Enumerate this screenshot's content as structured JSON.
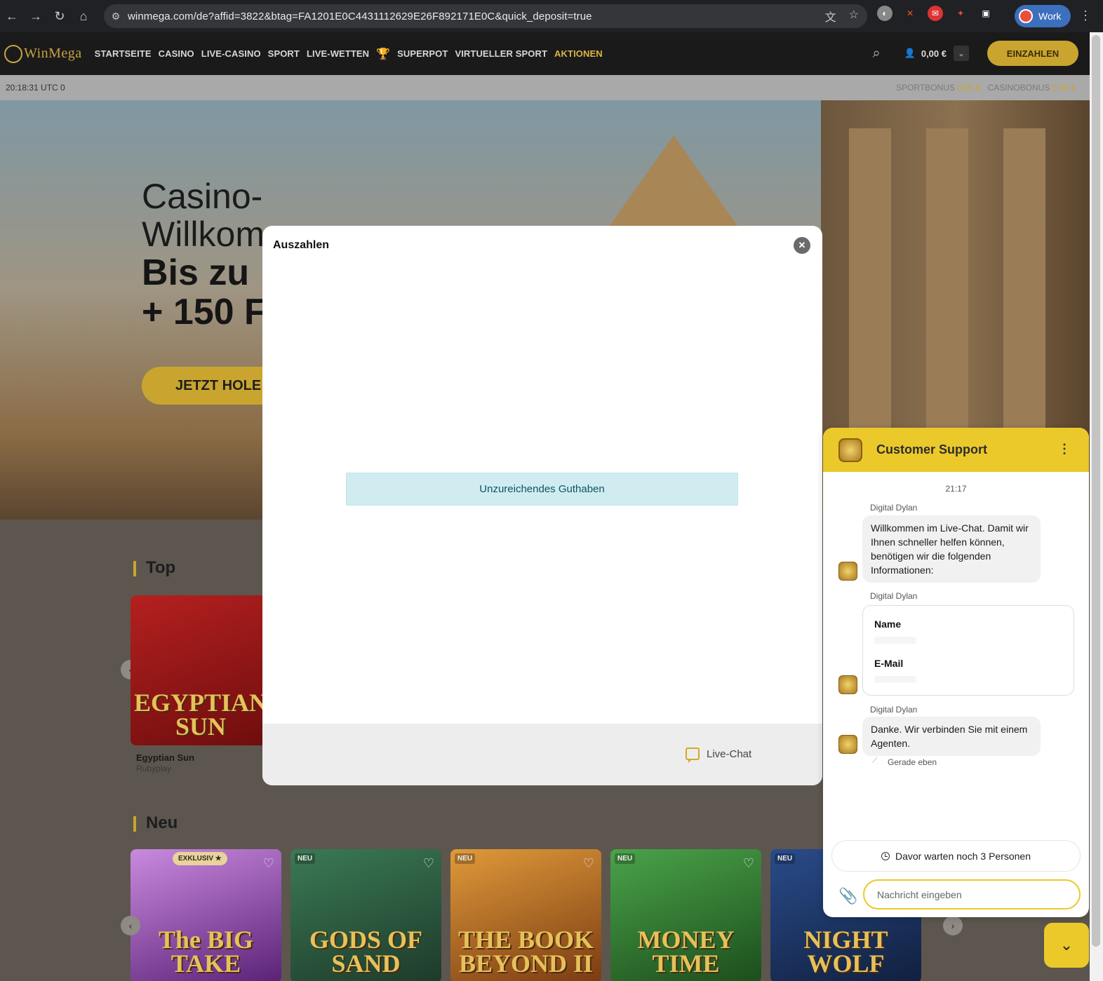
{
  "browser": {
    "url": "winmega.com/de?affid=3822&btag=FA1201E0C4431112629E26F892171E0C&quick_deposit=true",
    "profile_label": "Work"
  },
  "site": {
    "logo_text": "WinMega",
    "menu": [
      "STARTSEITE",
      "CASINO",
      "LIVE-CASINO",
      "SPORT",
      "LIVE-WETTEN",
      "SUPERPOT",
      "VIRTUELLER SPORT",
      "AKTIONEN"
    ],
    "balance": "0,00 €",
    "deposit_label": "EINZAHLEN",
    "clock": "20:18:31 UTC 0",
    "sportbonus_label": "SPORTBONUS",
    "sportbonus_value": "0,00 €",
    "casinobonus_label": "CASINOBONUS",
    "casinobonus_value": "0,00 €",
    "accent": "#c9a52f"
  },
  "hero": {
    "line1": "Casino-",
    "line2": "Willkom",
    "line3": "Bis zu",
    "line4": "+ 150 F",
    "cta": "JETZT HOLE"
  },
  "sections": {
    "top_title": "Top",
    "new_title": "Neu",
    "top_game": {
      "name": "Egyptian Sun",
      "provider": "Rubyplay",
      "art": "EGYPTIAN SUN"
    },
    "new_games": [
      {
        "badge": "EXKLUSIV ★",
        "art": "The BIG TAKE"
      },
      {
        "badge": "NEU",
        "art": "GODS OF SAND"
      },
      {
        "badge": "NEU",
        "art": "THE BOOK BEYOND II"
      },
      {
        "badge": "NEU",
        "art": "MONEY TIME"
      },
      {
        "badge": "NEU",
        "art": "NIGHT WOLF"
      }
    ]
  },
  "modal": {
    "title": "Auszahlen",
    "alert": "Unzureichendes Guthaben",
    "livechat": "Live-Chat"
  },
  "chat": {
    "title": "Customer Support",
    "time": "21:17",
    "sender": "Digital Dylan",
    "msg1": "Willkommen im Live-Chat. Damit wir Ihnen schneller helfen können, benötigen wir die folgenden Informationen:",
    "form_name": "Name",
    "form_email": "E-Mail",
    "msg2": "Danke. Wir verbinden Sie mit einem Agenten.",
    "status": "Gerade eben",
    "queue": "Davor warten noch 3 Personen",
    "input_placeholder": "Nachricht eingeben",
    "accent": "#ecc92a"
  }
}
